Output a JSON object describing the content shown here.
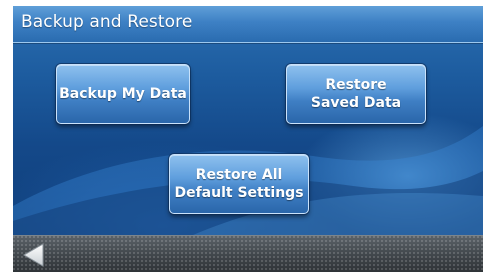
{
  "header": {
    "title": "Backup and Restore"
  },
  "buttons": {
    "backup_my_data": "Backup My Data",
    "restore_saved_data": "Restore\nSaved Data",
    "restore_all_defaults": "Restore All\nDefault Settings"
  },
  "nav": {
    "back_icon": "back-arrow-icon"
  },
  "colors": {
    "title_bar": "#3d80c4",
    "button": "#5f9edd",
    "background": "#14498a",
    "bottom_bar": "#41474c"
  }
}
